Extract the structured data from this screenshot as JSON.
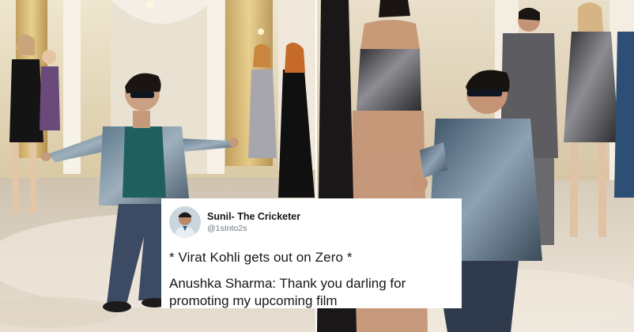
{
  "tweet": {
    "name": "Sunil- The Cricketer",
    "handle": "@1sInto2s",
    "line1": "* Virat Kohli gets out on Zero *",
    "line2a": "Anushka Sharma: Thank you darling for",
    "line2b": "promoting my upcoming film"
  },
  "colors": {
    "tweet_bg": "#ffffff",
    "text": "#14171a",
    "handle": "#657786"
  }
}
